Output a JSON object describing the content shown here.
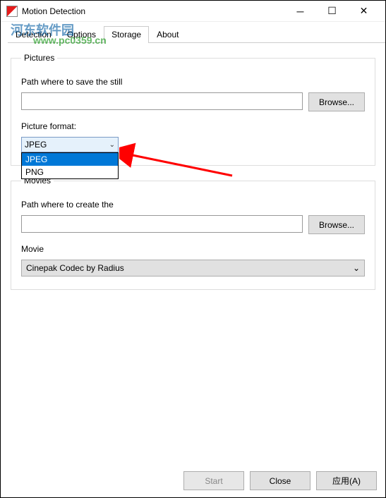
{
  "titlebar": {
    "title": "Motion Detection"
  },
  "watermark": {
    "line1": "河东软件园",
    "line2": "www.pc0359.cn"
  },
  "tabs": {
    "detection": "Detection",
    "options": "Options",
    "storage": "Storage",
    "about": "About"
  },
  "pictures": {
    "legend": "Pictures",
    "path_label": "Path where to save the still",
    "path_value": "",
    "browse_label": "Browse...",
    "format_label": "Picture format:",
    "format_selected": "JPEG",
    "format_options": {
      "opt1": "JPEG",
      "opt2": "PNG"
    }
  },
  "movies": {
    "legend": "Movies",
    "path_label": "Path where to create the",
    "path_value": "",
    "browse_label": "Browse...",
    "codec_label": "Movie",
    "codec_value": "Cinepak Codec by Radius"
  },
  "buttons": {
    "start": "Start",
    "close": "Close",
    "apply": "应用(A)"
  }
}
